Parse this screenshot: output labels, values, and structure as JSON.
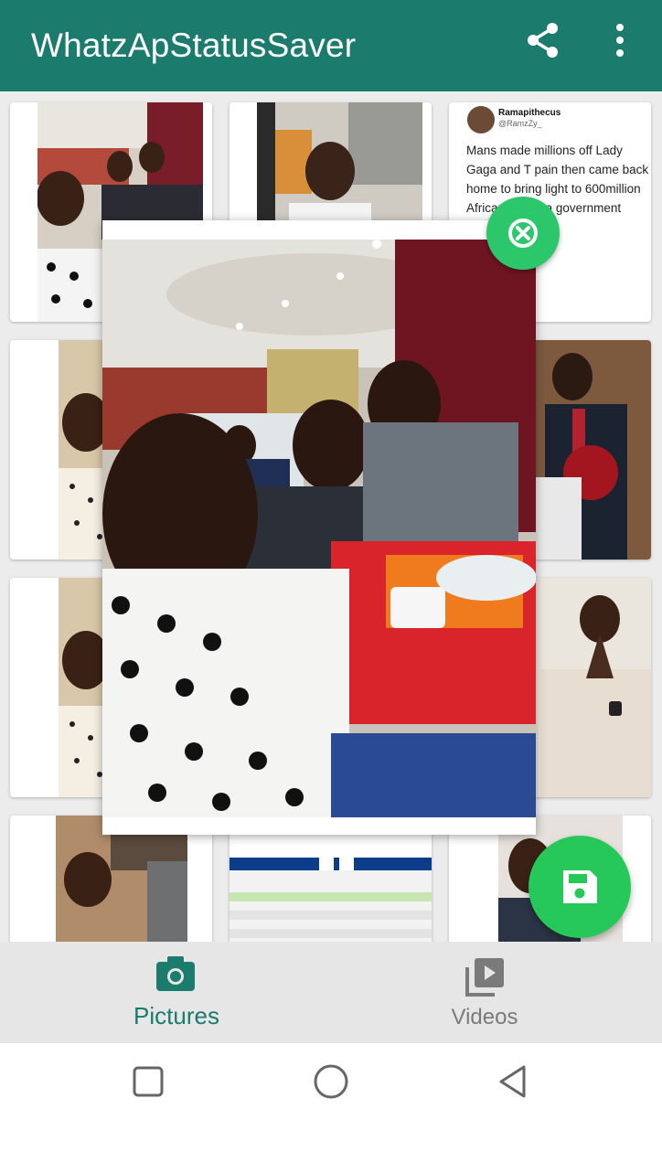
{
  "app": {
    "title": "WhatzApStatusSaver"
  },
  "toolbar": {
    "share_icon": "share-icon",
    "overflow_icon": "more-vert-icon"
  },
  "tweet": {
    "user": "Ramapithecus",
    "handle": "@RamzZy_",
    "text": "Mans made millions off Lady Gaga and T pain then came back home to bring light to 600million Africans. He's a government now."
  },
  "tabs": [
    {
      "label": "Pictures",
      "icon": "camera-icon",
      "selected": true
    },
    {
      "label": "Videos",
      "icon": "video-library-icon",
      "selected": false
    }
  ],
  "colors": {
    "primary": "#1b7b6d",
    "fab": "#27c85a",
    "close": "#2cc76a"
  }
}
